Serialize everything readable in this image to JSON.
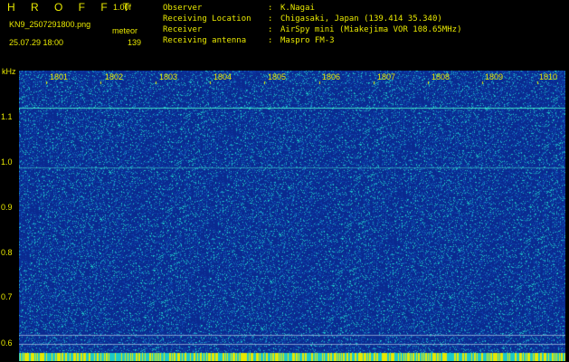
{
  "header": {
    "app_title": "H R O F F T",
    "version": "1.00f",
    "file_name": "KN9_2507291800.png",
    "meteor_label": "meteor",
    "timestamp": "25.07.29 18:00",
    "meteor_count": "139"
  },
  "info": [
    {
      "label": "Observer",
      "value": "K.Nagai"
    },
    {
      "label": "Receiving Location",
      "value": "Chigasaki, Japan (139.414 35.340)"
    },
    {
      "label": "Receiver",
      "value": "AirSpy mini (Miakejima VOR 108.65MHz)"
    },
    {
      "label": "Receiving antenna",
      "value": "Maspro FM-3"
    }
  ],
  "plot": {
    "y_unit": "kHz",
    "y_ticks": [
      "1.1",
      "1.0",
      "0.9",
      "0.8",
      "0.7",
      "0.6"
    ],
    "x_ticks": [
      "1801",
      "1802",
      "1803",
      "1804",
      "1805",
      "1806",
      "1807",
      "1808",
      "1809",
      "1810"
    ],
    "background_color": "#0a2a90",
    "noise_color": "#1dc8c8",
    "highlight_color": "#e8e800"
  }
}
